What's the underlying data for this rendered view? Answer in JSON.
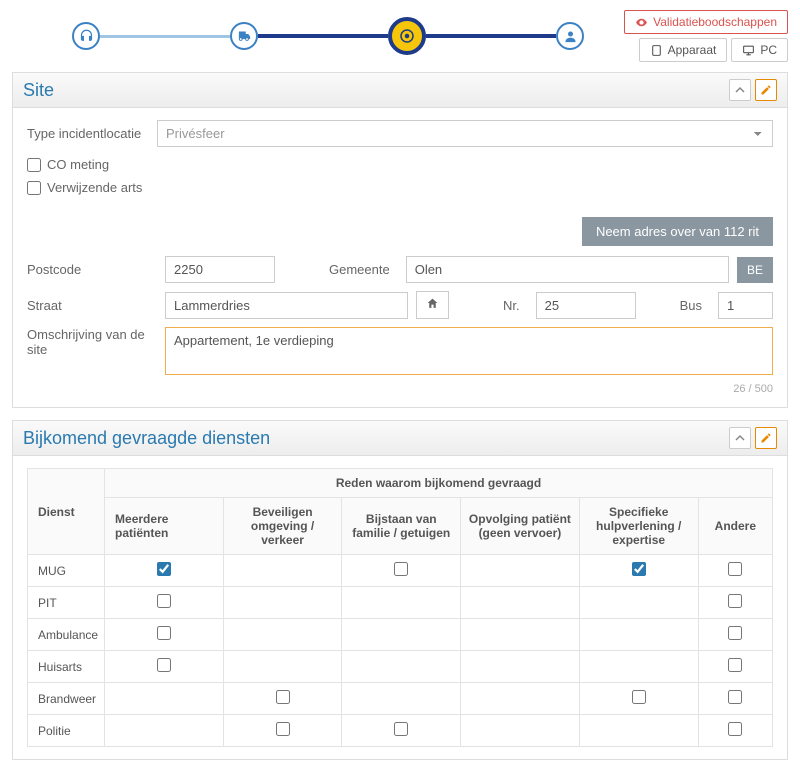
{
  "topButtons": {
    "validation": "Validatieboodschappen",
    "device": "Apparaat",
    "pc": "PC"
  },
  "sitePanel": {
    "title": "Site",
    "typeLabel": "Type incidentlocatie",
    "typeValue": "Privésfeer",
    "coLabel": "CO meting",
    "refLabel": "Verwijzende arts",
    "takeAddressBtn": "Neem adres over van 112 rit",
    "postcodeLabel": "Postcode",
    "postcodeValue": "2250",
    "gemeenteLabel": "Gemeente",
    "gemeenteValue": "Olen",
    "countryBtn": "BE",
    "straatLabel": "Straat",
    "straatValue": "Lammerdries",
    "nrLabel": "Nr.",
    "nrValue": "25",
    "busLabel": "Bus",
    "busValue": "1",
    "descLabel": "Omschrijving van de site",
    "descValue": "Appartement, 1e verdieping",
    "counter": "26 / 500"
  },
  "servicesPanel": {
    "title": "Bijkomend gevraagde diensten",
    "dienstHeader": "Dienst",
    "reasonHeader": "Reden waarom bijkomend gevraagd",
    "cols": [
      "Meerdere patiënten",
      "Beveiligen omgeving / verkeer",
      "Bijstaan van familie / getuigen",
      "Opvolging patiënt (geen vervoer)",
      "Specifieke hulpverlening / expertise",
      "Andere"
    ],
    "rows": [
      {
        "name": "MUG",
        "cells": [
          true,
          null,
          false,
          null,
          true,
          false
        ]
      },
      {
        "name": "PIT",
        "cells": [
          false,
          null,
          null,
          null,
          null,
          false
        ]
      },
      {
        "name": "Ambulance",
        "cells": [
          false,
          null,
          null,
          null,
          null,
          false
        ]
      },
      {
        "name": "Huisarts",
        "cells": [
          false,
          null,
          null,
          null,
          null,
          false
        ]
      },
      {
        "name": "Brandweer",
        "cells": [
          null,
          false,
          null,
          null,
          false,
          false
        ]
      },
      {
        "name": "Politie",
        "cells": [
          null,
          false,
          false,
          null,
          null,
          false
        ]
      }
    ]
  }
}
